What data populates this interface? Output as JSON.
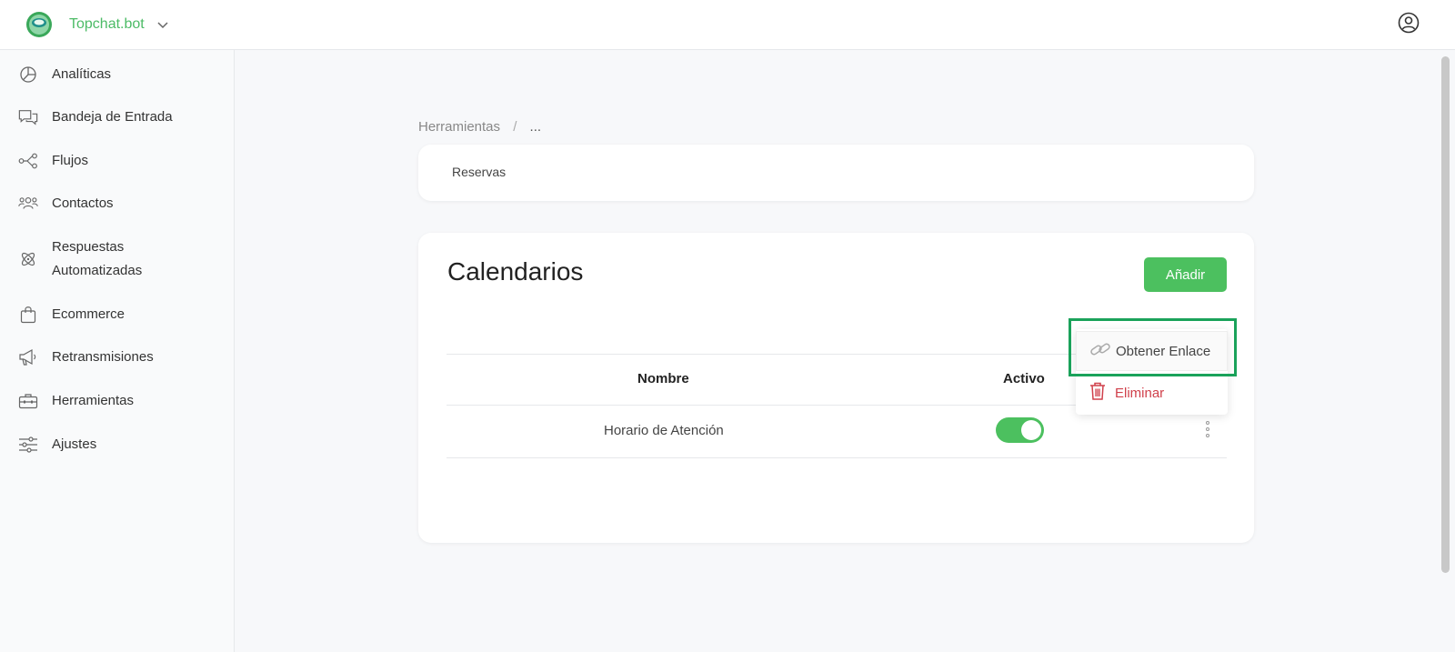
{
  "header": {
    "brand_name": "Topchat.bot",
    "brand_color": "#4cbb66"
  },
  "sidebar": {
    "items": [
      {
        "label": "Analíticas",
        "icon": "pie-chart-icon"
      },
      {
        "label": "Bandeja de Entrada",
        "icon": "chat-bubbles-icon"
      },
      {
        "label": "Flujos",
        "icon": "flow-icon"
      },
      {
        "label": "Contactos",
        "icon": "people-icon"
      },
      {
        "label": "Respuestas\nAutomatizadas",
        "icon": "atom-icon"
      },
      {
        "label": "Ecommerce",
        "icon": "shopping-bag-icon"
      },
      {
        "label": "Retransmisiones",
        "icon": "megaphone-icon"
      },
      {
        "label": "Herramientas",
        "icon": "toolbox-icon"
      },
      {
        "label": "Ajustes",
        "icon": "sliders-icon"
      }
    ]
  },
  "breadcrumb": {
    "parent": "Herramientas",
    "separator": "/",
    "current": "..."
  },
  "tabs": {
    "reservas": "Reservas"
  },
  "calendars": {
    "title": "Calendarios",
    "add_label": "Añadir",
    "accent_color": "#4cc05f",
    "columns": [
      "Nombre",
      "Activo"
    ],
    "rows": [
      {
        "name": "Horario de Atención",
        "active": true
      }
    ]
  },
  "row_menu": {
    "get_link_label": "Obtener Enlace",
    "delete_label": "Eliminar",
    "delete_color": "#d0404b"
  }
}
